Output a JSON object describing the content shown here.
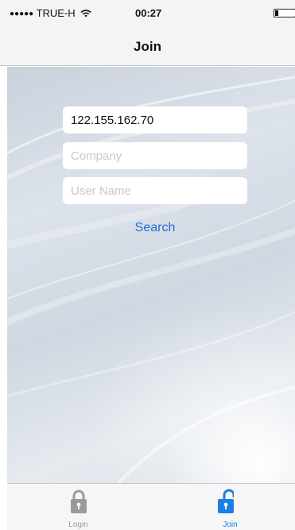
{
  "status_bar": {
    "signal_dots": "●●●●●",
    "carrier": "TRUE-H",
    "time": "00:27",
    "wifi_icon": "wifi-icon",
    "battery_icon": "battery-icon"
  },
  "nav": {
    "title": "Join"
  },
  "form": {
    "server_value": "122.155.162.70",
    "company_placeholder": "Company",
    "username_placeholder": "User Name",
    "search_label": "Search"
  },
  "tabs": [
    {
      "label": "Login",
      "icon": "lock-closed-icon",
      "active": false,
      "color": "#9a9a9a"
    },
    {
      "label": "Join",
      "icon": "lock-open-icon",
      "active": true,
      "color": "#1a80e6"
    }
  ],
  "colors": {
    "accent": "#1a6fd6",
    "tab_active": "#1a80e6",
    "tab_inactive": "#9a9a9a"
  }
}
